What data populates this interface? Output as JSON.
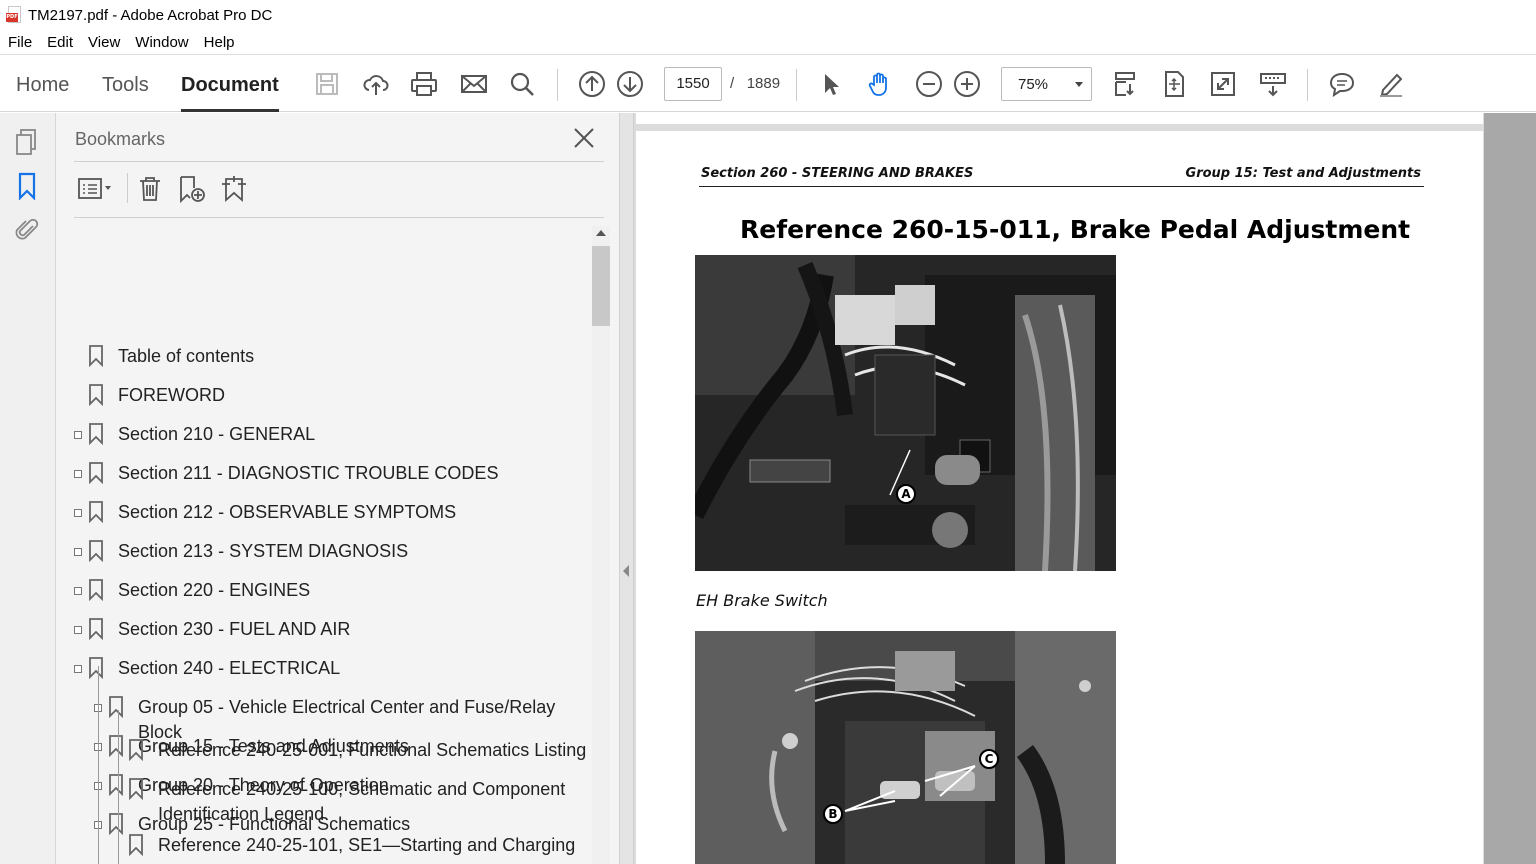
{
  "window": {
    "title": "TM2197.pdf - Adobe Acrobat Pro DC"
  },
  "menu": [
    "File",
    "Edit",
    "View",
    "Window",
    "Help"
  ],
  "tabs": {
    "home": "Home",
    "tools": "Tools",
    "document": "Document"
  },
  "navigation": {
    "current_page": "1550",
    "separator": "/",
    "total_pages": "1889"
  },
  "zoom": {
    "value": "75%"
  },
  "bookmarks": {
    "header": "Bookmarks",
    "items": [
      {
        "label": "Table of contents"
      },
      {
        "label": "FOREWORD"
      },
      {
        "label": "Section 210 - GENERAL"
      },
      {
        "label": "Section 211 - DIAGNOSTIC TROUBLE CODES"
      },
      {
        "label": "Section 212 - OBSERVABLE SYMPTOMS"
      },
      {
        "label": "Section 213 - SYSTEM DIAGNOSIS"
      },
      {
        "label": "Section 220 - ENGINES"
      },
      {
        "label": "Section 230 - FUEL AND AIR"
      },
      {
        "label": "Section 240 - ELECTRICAL"
      },
      {
        "label": "Group 05 - Vehicle Electrical Center and Fuse/Relay Block"
      },
      {
        "label": "Group 15 - Tests and Adjustments"
      },
      {
        "label": "Group 20 - Theory of Operation"
      },
      {
        "label": "Group 25 - Functional Schematics"
      },
      {
        "label": "Reference 240-25-001, Functional Schematics Listing"
      },
      {
        "label": "Reference 240-25-100, Schematic and Component",
        "label2": "Identification Legend"
      },
      {
        "label": "Reference 240-25-101, SE1—Starting and Charging"
      }
    ]
  },
  "document": {
    "header_left": "Section 260 - STEERING AND BRAKES",
    "header_right": "Group 15: Test and Adjustments",
    "title": "Reference 260-15-011, Brake Pedal Adjustment",
    "caption1": "EH Brake Switch",
    "callouts": {
      "a": "A",
      "b": "B",
      "c": "C"
    }
  }
}
